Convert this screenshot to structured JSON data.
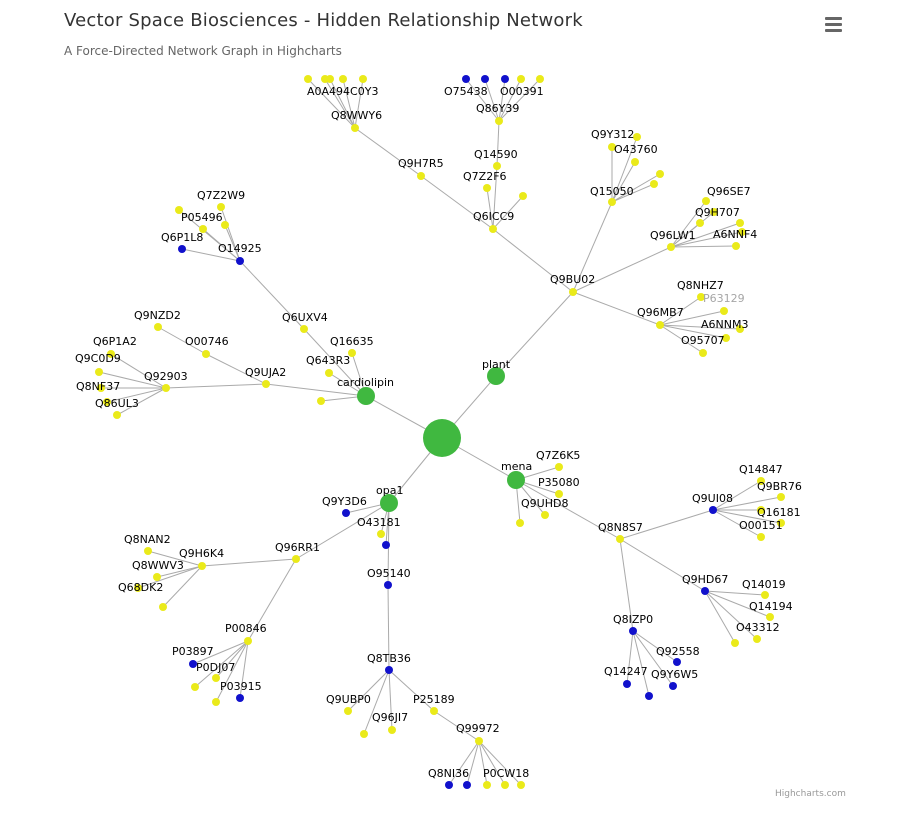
{
  "header": {
    "title": "Vector Space Biosciences - Hidden Relationship Network",
    "subtitle": "A Force-Directed Network Graph in Highcharts"
  },
  "menu": {
    "icon": "hamburger-menu-icon"
  },
  "credits": "Highcharts.com",
  "colors": {
    "node_yellow": "#eaea1a",
    "node_blue": "#1111cc",
    "node_green": "#40b840",
    "link": "#aaaaaa",
    "faded_label": "#a6a6a6"
  },
  "chart_data": {
    "type": "network",
    "nodes": [
      {
        "id": "hub",
        "label": "",
        "color": "green"
      },
      {
        "id": "plant",
        "label": "plant",
        "color": "green"
      },
      {
        "id": "cardiolipin",
        "label": "cardiolipin",
        "color": "green"
      },
      {
        "id": "mena",
        "label": "mena",
        "color": "green"
      },
      {
        "id": "opa1",
        "label": "opa1",
        "color": "green"
      },
      {
        "id": "Q9BU02",
        "label": "Q9BU02",
        "color": "yellow"
      },
      {
        "id": "Q6ICC9",
        "label": "Q6ICC9",
        "color": "yellow"
      },
      {
        "id": "Q9H7R5",
        "label": "Q9H7R5",
        "color": "yellow"
      },
      {
        "id": "Q8WWY6",
        "label": "Q8WWY6",
        "color": "yellow"
      },
      {
        "id": "A0A494C0Y3",
        "label": "A0A494C0Y3",
        "color": "yellow"
      },
      {
        "id": "Q14590",
        "label": "Q14590",
        "color": "yellow"
      },
      {
        "id": "Q7Z2F6",
        "label": "Q7Z2F6",
        "color": "yellow"
      },
      {
        "id": "Q86Y39",
        "label": "Q86Y39",
        "color": "yellow"
      },
      {
        "id": "O75438",
        "label": "O75438",
        "color": "blue"
      },
      {
        "id": "O00391",
        "label": "O00391",
        "color": "yellow"
      },
      {
        "id": "Q15050",
        "label": "Q15050",
        "color": "yellow"
      },
      {
        "id": "Q9Y312",
        "label": "Q9Y312",
        "color": "yellow"
      },
      {
        "id": "O43760",
        "label": "O43760",
        "color": "yellow"
      },
      {
        "id": "Q96LW1",
        "label": "Q96LW1",
        "color": "yellow"
      },
      {
        "id": "Q96SE7",
        "label": "Q96SE7",
        "color": "yellow"
      },
      {
        "id": "Q9H707",
        "label": "Q9H707",
        "color": "yellow"
      },
      {
        "id": "A6NNF4",
        "label": "A6NNF4",
        "color": "yellow"
      },
      {
        "id": "Q96MB7",
        "label": "Q96MB7",
        "color": "yellow"
      },
      {
        "id": "Q8NHZ7",
        "label": "Q8NHZ7",
        "color": "yellow"
      },
      {
        "id": "P63129",
        "label": "P63129",
        "color": "yellow"
      },
      {
        "id": "A6NNM3",
        "label": "A6NNM3",
        "color": "yellow"
      },
      {
        "id": "O95707",
        "label": "O95707",
        "color": "yellow"
      },
      {
        "id": "Q9UJA2",
        "label": "Q9UJA2",
        "color": "yellow"
      },
      {
        "id": "O00746",
        "label": "O00746",
        "color": "yellow"
      },
      {
        "id": "Q9NZD2",
        "label": "Q9NZD2",
        "color": "yellow"
      },
      {
        "id": "Q92903",
        "label": "Q92903",
        "color": "yellow"
      },
      {
        "id": "Q6P1A2",
        "label": "Q6P1A2",
        "color": "yellow"
      },
      {
        "id": "Q9C0D9",
        "label": "Q9C0D9",
        "color": "yellow"
      },
      {
        "id": "Q8NF37",
        "label": "Q8NF37",
        "color": "yellow"
      },
      {
        "id": "Q86UL3",
        "label": "Q86UL3",
        "color": "yellow"
      },
      {
        "id": "Q6UXV4",
        "label": "Q6UXV4",
        "color": "yellow"
      },
      {
        "id": "O14925",
        "label": "O14925",
        "color": "blue"
      },
      {
        "id": "Q7Z2W9",
        "label": "Q7Z2W9",
        "color": "yellow"
      },
      {
        "id": "P05496",
        "label": "P05496",
        "color": "yellow"
      },
      {
        "id": "Q6P1L8",
        "label": "Q6P1L8",
        "color": "blue"
      },
      {
        "id": "Q16635",
        "label": "Q16635",
        "color": "yellow"
      },
      {
        "id": "Q643R3",
        "label": "Q643R3",
        "color": "yellow"
      },
      {
        "id": "Q7Z6K5",
        "label": "Q7Z6K5",
        "color": "yellow"
      },
      {
        "id": "P35080",
        "label": "P35080",
        "color": "yellow"
      },
      {
        "id": "Q9UHD8",
        "label": "Q9UHD8",
        "color": "yellow"
      },
      {
        "id": "Q8N8S7",
        "label": "Q8N8S7",
        "color": "yellow"
      },
      {
        "id": "Q9UI08",
        "label": "Q9UI08",
        "color": "blue"
      },
      {
        "id": "Q14847",
        "label": "Q14847",
        "color": "yellow"
      },
      {
        "id": "Q9BR76",
        "label": "Q9BR76",
        "color": "yellow"
      },
      {
        "id": "Q16181",
        "label": "Q16181",
        "color": "yellow"
      },
      {
        "id": "O00151",
        "label": "O00151",
        "color": "yellow"
      },
      {
        "id": "Q9HD67",
        "label": "Q9HD67",
        "color": "blue"
      },
      {
        "id": "Q14019",
        "label": "Q14019",
        "color": "yellow"
      },
      {
        "id": "Q14194",
        "label": "Q14194",
        "color": "yellow"
      },
      {
        "id": "O43312",
        "label": "O43312",
        "color": "yellow"
      },
      {
        "id": "Q8IZP0",
        "label": "Q8IZP0",
        "color": "blue"
      },
      {
        "id": "Q92558",
        "label": "Q92558",
        "color": "blue"
      },
      {
        "id": "Q14247",
        "label": "Q14247",
        "color": "blue"
      },
      {
        "id": "Q9Y6W5",
        "label": "Q9Y6W5",
        "color": "blue"
      },
      {
        "id": "Q9Y3D6",
        "label": "Q9Y3D6",
        "color": "blue"
      },
      {
        "id": "O43181",
        "label": "O43181",
        "color": "yellow"
      },
      {
        "id": "Q96RR1",
        "label": "Q96RR1",
        "color": "yellow"
      },
      {
        "id": "Q9H6K4",
        "label": "Q9H6K4",
        "color": "yellow"
      },
      {
        "id": "Q8NAN2",
        "label": "Q8NAN2",
        "color": "yellow"
      },
      {
        "id": "Q8WWV3",
        "label": "Q8WWV3",
        "color": "yellow"
      },
      {
        "id": "Q68DK2",
        "label": "Q68DK2",
        "color": "yellow"
      },
      {
        "id": "P00846",
        "label": "P00846",
        "color": "yellow"
      },
      {
        "id": "P03897",
        "label": "P03897",
        "color": "blue"
      },
      {
        "id": "P0DJ07",
        "label": "P0DJ07",
        "color": "yellow"
      },
      {
        "id": "P03915",
        "label": "P03915",
        "color": "blue"
      },
      {
        "id": "O95140",
        "label": "O95140",
        "color": "blue"
      },
      {
        "id": "Q8TB36",
        "label": "Q8TB36",
        "color": "blue"
      },
      {
        "id": "Q9UBP0",
        "label": "Q9UBP0",
        "color": "yellow"
      },
      {
        "id": "Q96JI7",
        "label": "Q96JI7",
        "color": "yellow"
      },
      {
        "id": "P25189",
        "label": "P25189",
        "color": "yellow"
      },
      {
        "id": "Q99972",
        "label": "Q99972",
        "color": "yellow"
      },
      {
        "id": "Q8NI36",
        "label": "Q8NI36",
        "color": "blue"
      },
      {
        "id": "P0CW18",
        "label": "P0CW18",
        "color": "yellow"
      }
    ]
  }
}
